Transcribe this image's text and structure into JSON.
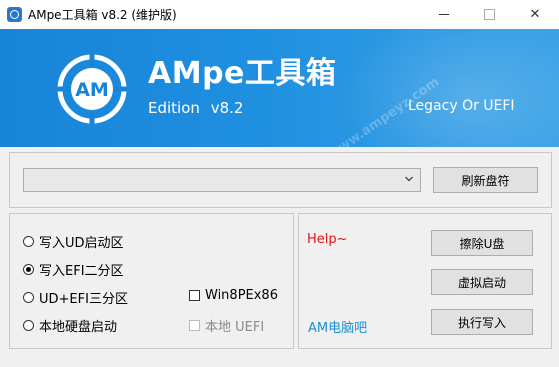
{
  "window": {
    "title": "AMpe工具箱 v8.2 (维护版)",
    "min_icon": "minimize-icon",
    "max_icon": "maximize-icon",
    "close_icon": "close-icon",
    "close_glyph": "✕"
  },
  "banner": {
    "brand": "AMpe工具箱",
    "edition_label": "Edition",
    "edition_version": "v8.2",
    "boot_mode": "Legacy Or UEFI",
    "watermark": "www.ampeyz.com",
    "logo_text": "AM",
    "colors": {
      "accent": "#1784d8"
    }
  },
  "disk": {
    "selected": "",
    "refresh_label": "刷新盘符"
  },
  "options": {
    "items": [
      {
        "label": "写入UD启动区",
        "selected": false
      },
      {
        "label": "写入EFI二分区",
        "selected": true
      },
      {
        "label": "UD+EFI三分区",
        "selected": false
      },
      {
        "label": "本地硬盘启动",
        "selected": false
      }
    ],
    "win8pe_label": "Win8PEx86",
    "local_uefi_label": "本地 UEFI"
  },
  "actions": {
    "help_text": "Help~",
    "am_link": "AM电脑吧",
    "erase_label": "擦除U盘",
    "virtual_boot_label": "虚拟启动",
    "execute_label": "执行写入"
  }
}
